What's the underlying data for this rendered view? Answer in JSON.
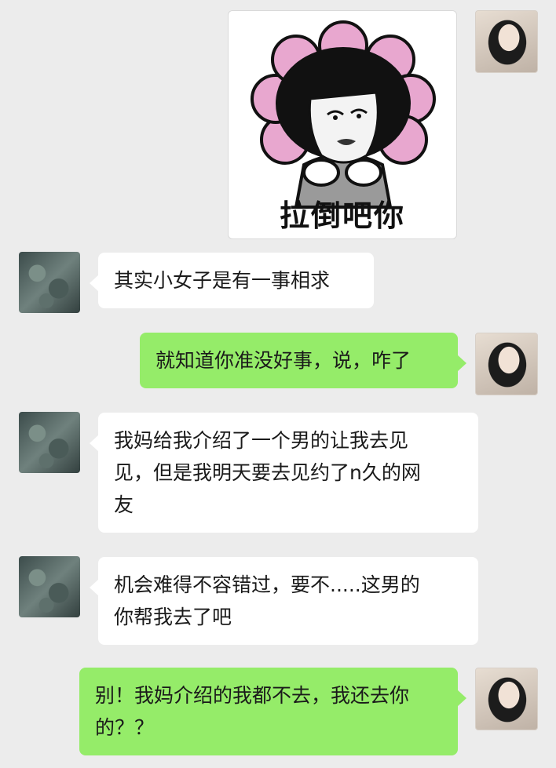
{
  "chat": {
    "sticker": {
      "caption": "拉倒吧你",
      "icon": "mushroom-head-girl-meme-sticker"
    },
    "messages": [
      {
        "side": "left",
        "text": "其实小女子是有一事相求"
      },
      {
        "side": "right",
        "text": "就知道你准没好事，说，咋了"
      },
      {
        "side": "left",
        "text": "我妈给我介绍了一个男的让我去见\n见，但是我明天要去见约了n久的网\n友"
      },
      {
        "side": "left",
        "text": "机会难得不容错过，要不.....这男的\n你帮我去了吧"
      },
      {
        "side": "right",
        "text": "别！我妈介绍的我都不去，我还去你\n的？？"
      }
    ]
  },
  "colors": {
    "background": "#ececec",
    "outgoing_bubble": "#95ec69",
    "incoming_bubble": "#ffffff"
  }
}
